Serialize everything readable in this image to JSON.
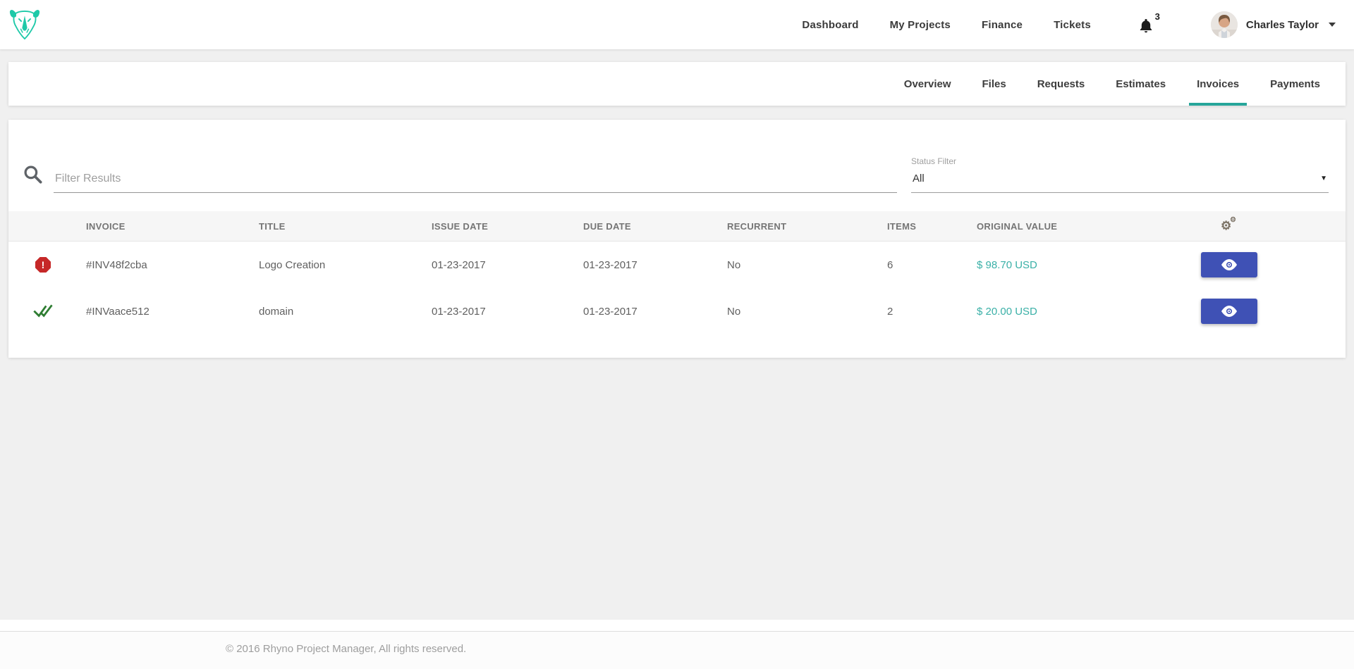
{
  "brand": {
    "logo_name": "rhino-logo",
    "accent_color": "#1ec9a8"
  },
  "topnav": {
    "items": [
      {
        "label": "Dashboard"
      },
      {
        "label": "My Projects"
      },
      {
        "label": "Finance"
      },
      {
        "label": "Tickets"
      }
    ],
    "notifications_count": "3",
    "user_name": "Charles Taylor"
  },
  "tabs": {
    "items": [
      {
        "label": "Overview",
        "active": false
      },
      {
        "label": "Files",
        "active": false
      },
      {
        "label": "Requests",
        "active": false
      },
      {
        "label": "Estimates",
        "active": false
      },
      {
        "label": "Invoices",
        "active": true
      },
      {
        "label": "Payments",
        "active": false
      }
    ],
    "active_underline_color": "#26a69a"
  },
  "filter": {
    "search_placeholder": "Filter Results",
    "status_label": "Status Filter",
    "status_value": "All"
  },
  "table": {
    "columns": [
      "INVOICE",
      "TITLE",
      "ISSUE DATE",
      "DUE DATE",
      "RECURRENT",
      "ITEMS",
      "ORIGINAL VALUE"
    ],
    "rows": [
      {
        "status": "overdue",
        "invoice": "#INV48f2cba",
        "title": "Logo Creation",
        "issue_date": "01-23-2017",
        "due_date": "01-23-2017",
        "recurrent": "No",
        "items": "6",
        "value": "$ 98.70 USD"
      },
      {
        "status": "paid",
        "invoice": "#INVaace512",
        "title": "domain",
        "issue_date": "01-23-2017",
        "due_date": "01-23-2017",
        "recurrent": "No",
        "items": "2",
        "value": "$ 20.00 USD"
      }
    ]
  },
  "footer": {
    "copyright": "© 2016 Rhyno Project Manager, All rights reserved."
  },
  "colors": {
    "accent_teal": "#1ec9a8",
    "tab_underline": "#26a69a",
    "money_text": "#3ab0a7",
    "button_indigo": "#3f51b5",
    "status_overdue_red": "#c62828",
    "status_paid_green": "#2e7d32",
    "page_background": "#f0f0f0"
  }
}
